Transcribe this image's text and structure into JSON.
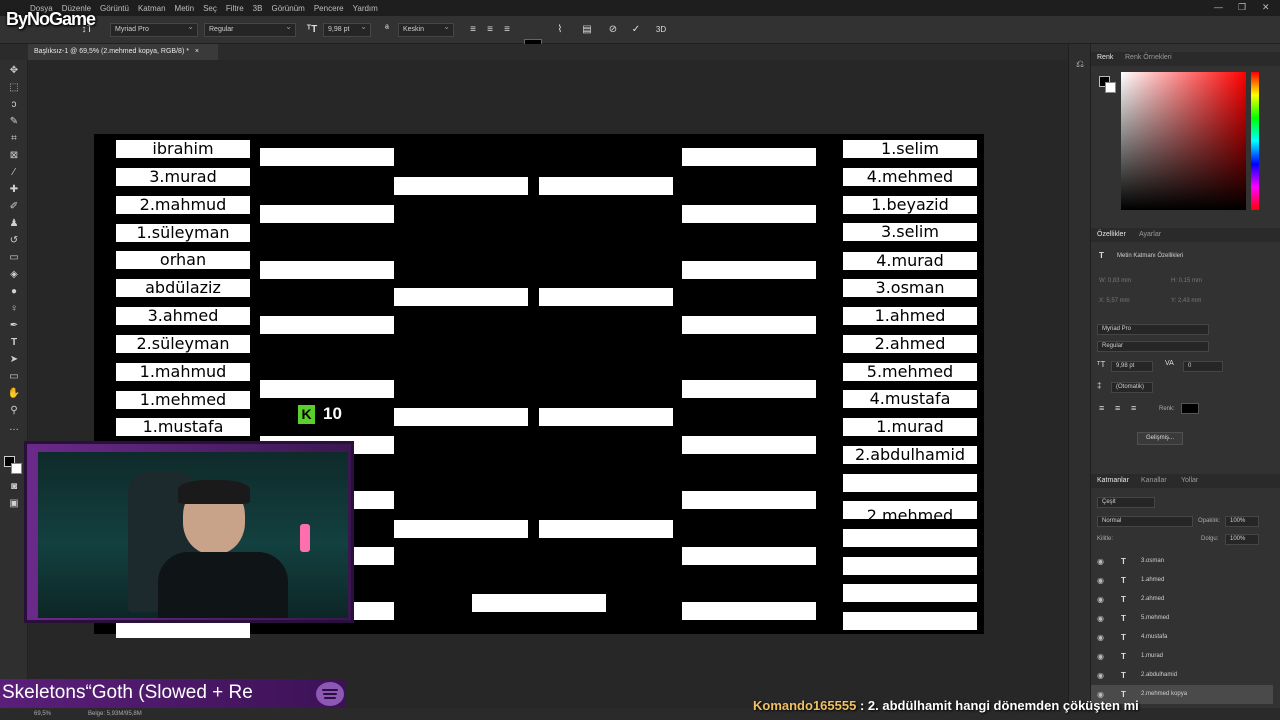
{
  "menubar": {
    "items": [
      "Dosya",
      "Düzenle",
      "Görüntü",
      "Katman",
      "Metin",
      "Seç",
      "Filtre",
      "3B",
      "Görünüm",
      "Pencere",
      "Yardım"
    ]
  },
  "options": {
    "font_family": "Myriad Pro",
    "font_style": "Regular",
    "font_size": "9,98 pt",
    "antialias": "Keskin",
    "color": "#000000"
  },
  "document_tab": "Başlıksız-1 @ 69,5% (2.mehmed kopya, RGB/8) *",
  "left_names": [
    "ibrahim",
    "3.murad",
    "2.mahmud",
    "1.süleyman",
    "orhan",
    "abdülaziz",
    "3.ahmed",
    "2.süleyman",
    "1.mahmud",
    "1.mehmed",
    "1.mustafa"
  ],
  "right_names": [
    "1.selim",
    "4.mehmed",
    "1.beyazid",
    "3.selim",
    "4.murad",
    "3.osman",
    "1.ahmed",
    "2.ahmed",
    "5.mehmed",
    "4.mustafa",
    "1.murad",
    "2.abdulhamid",
    "",
    "2.mehmed"
  ],
  "canvas_badge": {
    "letter": "K",
    "number": "10"
  },
  "right_panel": {
    "color_tabs": [
      "Renk",
      "Renk Örnekleri"
    ],
    "props_tabs": [
      "Özellikler",
      "Ayarlar"
    ],
    "props_title": "Metin Katmanı Özellikleri",
    "props_font": "Myriad Pro",
    "props_style": "Regular",
    "props_size": "9,98 pt",
    "props_tracking": "0",
    "props_leading": "(Otomatik)",
    "props_color_label": "Renk:",
    "props_advanced": "Gelişmiş...",
    "props_w": "W: 0,83 mm",
    "props_h": "H: 0,15 mm",
    "props_x": "X: 5,57 mm",
    "props_y": "Y: 2,43 mm",
    "layers_tabs": [
      "Katmanlar",
      "Kanallar",
      "Yollar"
    ],
    "layer_filter": "Çeşit",
    "blend_mode": "Normal",
    "opacity_label": "Opaklık:",
    "opacity_value": "100%",
    "lock_label": "Kilitle:",
    "fill_label": "Dolgu:",
    "fill_value": "100%",
    "layers": [
      "3.osman",
      "1.ahmed",
      "2.ahmed",
      "5.mehmed",
      "4.mustafa",
      "1.murad",
      "2.abdulhamid",
      "2.mehmed kopya"
    ]
  },
  "status": {
    "zoom": "69,5%",
    "doc": "Belge: 5,93M/95,8M"
  },
  "overlay": {
    "logo": "ByNoGame",
    "music": "Skeletons“Goth (Slowed + Re",
    "chat_user": "Komando165555",
    "chat_msg": " : 2. abdülhamit hangi dönemden çöküşten mi"
  }
}
